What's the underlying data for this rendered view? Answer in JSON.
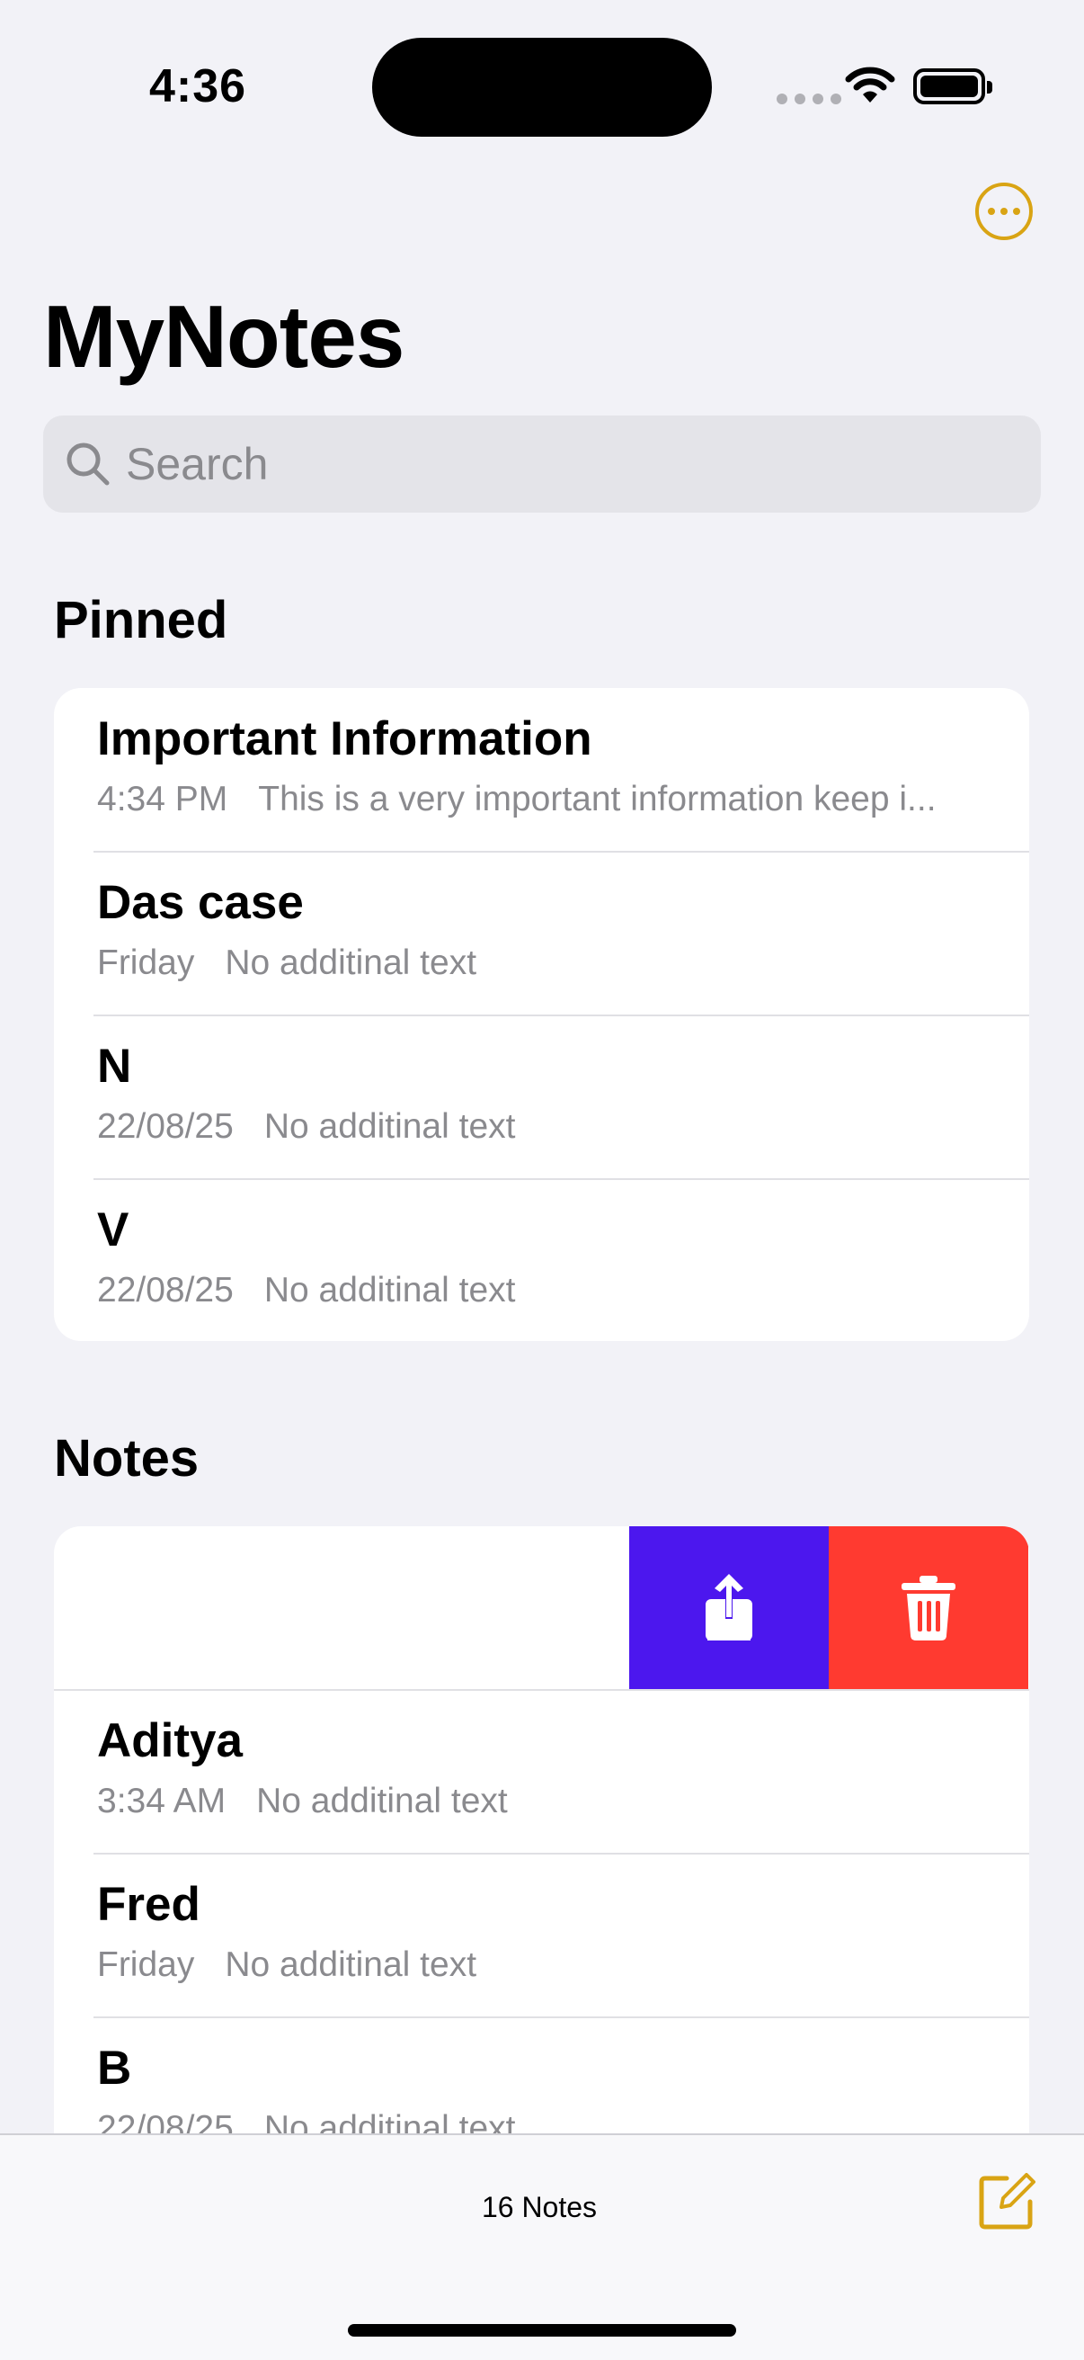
{
  "status_bar": {
    "time": "4:36"
  },
  "header": {
    "title": "MyNotes",
    "more_icon": "ellipsis-circle-icon"
  },
  "search": {
    "placeholder": "Search",
    "value": ""
  },
  "pinned": {
    "section_title": "Pinned",
    "items": [
      {
        "title": "Important Information",
        "date": "4:34 PM",
        "preview": "This is a very important information keep i..."
      },
      {
        "title": "Das case",
        "date": "Friday",
        "preview": "No additinal text"
      },
      {
        "title": "N",
        "date": "22/08/25",
        "preview": "No additinal text"
      },
      {
        "title": "V",
        "date": "22/08/25",
        "preview": "No additinal text"
      }
    ]
  },
  "notes": {
    "section_title": "Notes",
    "swipe_actions": {
      "share_icon": "share-icon",
      "delete_icon": "trash-icon"
    },
    "items": [
      {
        "title": "Aditya",
        "date": "3:34 AM",
        "preview": "No additinal text"
      },
      {
        "title": "Fred",
        "date": "Friday",
        "preview": "No additinal text"
      },
      {
        "title": "B",
        "date": "22/08/25",
        "preview": "No additinal text"
      }
    ]
  },
  "toolbar": {
    "count_label": "16 Notes",
    "compose_icon": "compose-icon"
  },
  "colors": {
    "accent": "#D9A414",
    "share": "#4C17EE",
    "delete": "#FF3A30",
    "background": "#F2F2F7"
  }
}
